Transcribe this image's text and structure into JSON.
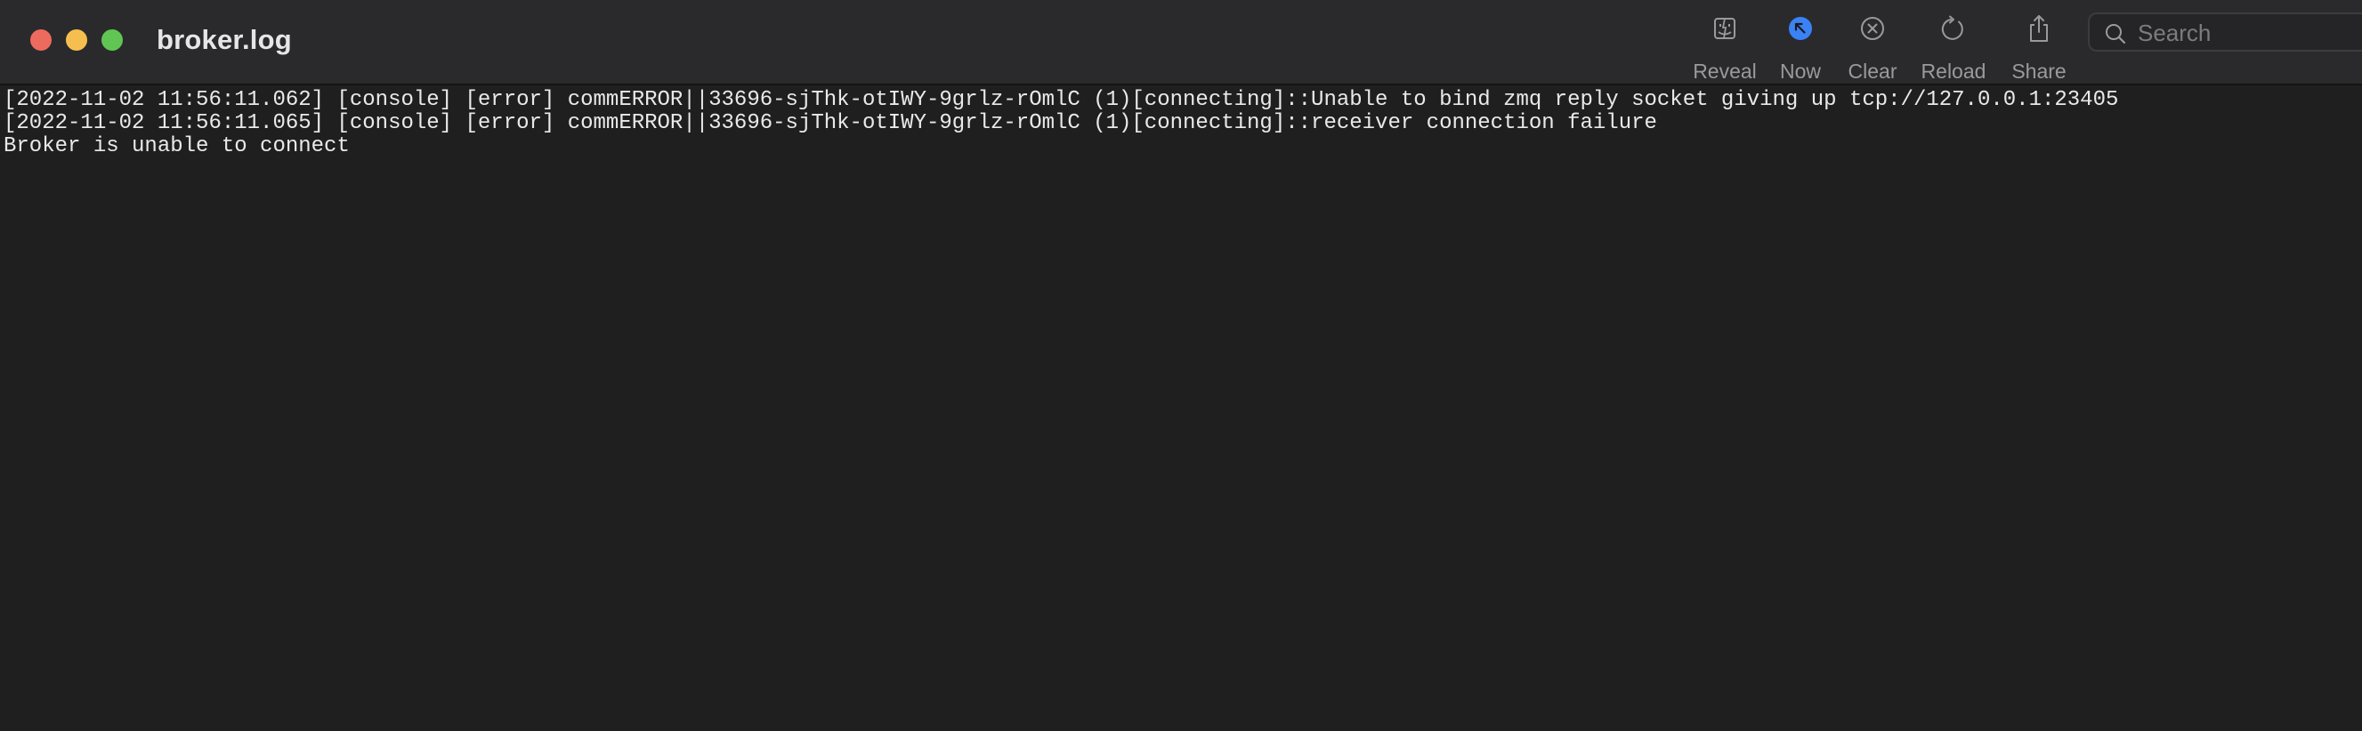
{
  "window": {
    "title": "broker.log"
  },
  "toolbar": {
    "reveal_label": "Reveal",
    "now_label": "Now",
    "clear_label": "Clear",
    "reload_label": "Reload",
    "share_label": "Share"
  },
  "search": {
    "placeholder": "Search",
    "value": ""
  },
  "icons": {
    "reveal": "finder-face-icon",
    "now": "arrow-up-left-circle-icon",
    "clear": "x-circle-icon",
    "reload": "circular-arrow-icon",
    "share": "share-icon",
    "search": "magnifier-icon"
  },
  "colors": {
    "background": "#1f1f1f",
    "titlebar": "#2a2a2c",
    "accent": "#3b82f6",
    "close": "#ed6a5e",
    "minimize": "#f5bf4f",
    "zoom": "#61c554"
  },
  "log": {
    "lines": [
      "[2022-11-02 11:56:11.062] [console] [error] commERROR||33696-sjThk-otIWY-9grlz-rOmlC (1)[connecting]::Unable to bind zmq reply socket giving up tcp://127.0.0.1:23405",
      "[2022-11-02 11:56:11.065] [console] [error] commERROR||33696-sjThk-otIWY-9grlz-rOmlC (1)[connecting]::receiver connection failure",
      "Broker is unable to connect"
    ]
  }
}
